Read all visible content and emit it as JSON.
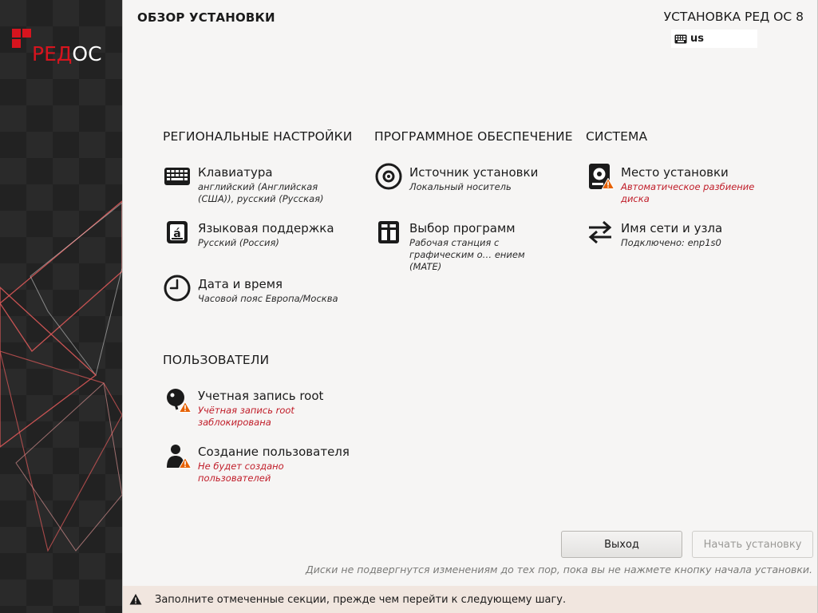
{
  "brand": {
    "logo_part1": "РЕД",
    "logo_part2": "ОС",
    "logo_color": "#d7141e"
  },
  "header": {
    "page_title": "ОБЗОР УСТАНОВКИ",
    "product_title": "УСТАНОВКА РЕД ОС 8",
    "keyboard_layout": "us",
    "keyboard_icon": "keyboard-icon"
  },
  "sections": {
    "localization": {
      "title": "РЕГИОНАЛЬНЫЕ НАСТРОЙКИ"
    },
    "software": {
      "title": "ПРОГРАММНОЕ ОБЕСПЕЧЕНИЕ"
    },
    "system": {
      "title": "СИСТЕМА"
    },
    "users": {
      "title": "ПОЛЬЗОВАТЕЛИ"
    }
  },
  "spokes": {
    "keyboard": {
      "name": "Клавиатура",
      "status": "английский (Английская (США)), русский (Русская)",
      "icon": "keyboard-icon",
      "warning": false
    },
    "language": {
      "name": "Языковая поддержка",
      "status": "Русский (Россия)",
      "icon": "language-icon",
      "warning": false
    },
    "datetime": {
      "name": "Дата и время",
      "status": "Часовой пояс Европа/Москва",
      "icon": "clock-icon",
      "warning": false
    },
    "source": {
      "name": "Источник установки",
      "status": "Локальный носитель",
      "icon": "disc-icon",
      "warning": false
    },
    "software": {
      "name": "Выбор программ",
      "status": "Рабочая станция с графическим о… ением (MATE)",
      "icon": "package-icon",
      "warning": false
    },
    "destination": {
      "name": "Место установки",
      "status": "Автоматическое разбиение диска",
      "icon": "harddisk-icon",
      "warning": true
    },
    "network": {
      "name": "Имя сети и узла",
      "status": "Подключено: enp1s0",
      "icon": "network-arrows-icon",
      "warning": false
    },
    "root": {
      "name": "Учетная запись root",
      "status": "Учётная запись root заблокирована",
      "icon": "root-icon",
      "warning": true
    },
    "user": {
      "name": "Создание пользователя",
      "status": "Не будет создано пользователей",
      "icon": "user-icon",
      "warning": true
    }
  },
  "footer": {
    "quit_label": "Выход",
    "begin_label": "Начать установку",
    "disk_note": "Диски не подвергнутся изменениям до тех пор, пока вы не нажмете кнопку начала установки.",
    "warning_message": "Заполните отмеченные секции, прежде чем перейти к следующему шагу."
  },
  "colors": {
    "background": "#f6f5f4",
    "warning_text": "#c01c28",
    "warning_badge": "#e66100",
    "warning_bar": "#f1e6df"
  }
}
